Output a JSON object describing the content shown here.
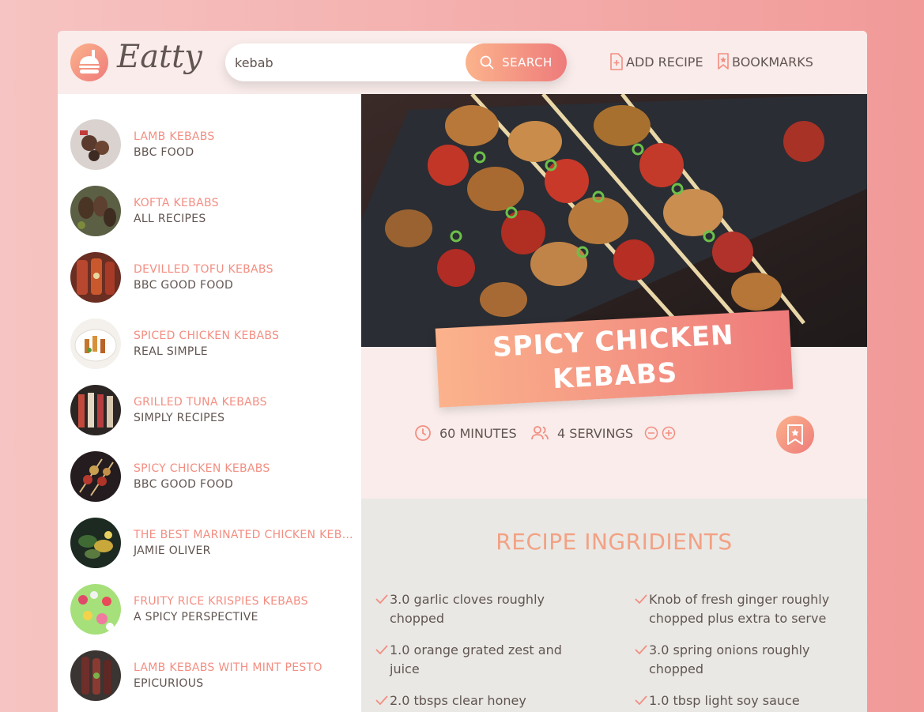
{
  "brand": {
    "name": "Eatty",
    "logo_icon": "burger-icon"
  },
  "search": {
    "value": "kebab",
    "button_label": "SEARCH"
  },
  "nav": {
    "add_recipe": "ADD RECIPE",
    "bookmarks": "BOOKMARKS"
  },
  "results": [
    {
      "title": "LAMB KEBABS",
      "publisher": "BBC FOOD"
    },
    {
      "title": "KOFTA KEBABS",
      "publisher": "ALL RECIPES"
    },
    {
      "title": "DEVILLED TOFU KEBABS",
      "publisher": "BBC GOOD FOOD"
    },
    {
      "title": "SPICED CHICKEN KEBABS",
      "publisher": "REAL SIMPLE"
    },
    {
      "title": "GRILLED TUNA KEBABS",
      "publisher": "SIMPLY RECIPES"
    },
    {
      "title": "SPICY CHICKEN KEBABS",
      "publisher": "BBC GOOD FOOD"
    },
    {
      "title": "THE BEST MARINATED CHICKEN KEBA...",
      "publisher": "JAMIE OLIVER"
    },
    {
      "title": "FRUITY RICE KRISPIES KEBABS",
      "publisher": "A SPICY PERSPECTIVE"
    },
    {
      "title": "LAMB KEBABS WITH MINT PESTO",
      "publisher": "EPICURIOUS"
    }
  ],
  "recipe": {
    "title": "SPICY CHICKEN KEBABS",
    "minutes": "60",
    "minutes_label": "MINUTES",
    "servings": "4",
    "servings_label": "SERVINGS",
    "ingredients_heading": "RECIPE INGRIDIENTS",
    "ingredients": [
      "3.0 garlic cloves roughly chopped",
      "Knob of fresh ginger roughly chopped plus extra to serve",
      "1.0 orange grated zest and juice",
      "3.0 spring onions roughly chopped",
      "2.0 tbsps clear honey",
      "1.0 tbsp light soy sauce"
    ]
  },
  "colors": {
    "accent": "#f38e82",
    "text": "#615551",
    "gradient_start": "#fbb38c",
    "gradient_end": "#ee7b7b"
  }
}
